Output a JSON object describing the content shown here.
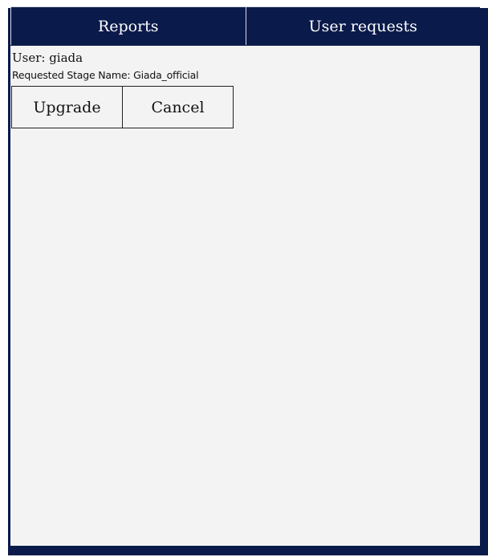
{
  "tabs": [
    {
      "label": "Reports"
    },
    {
      "label": "User requests"
    }
  ],
  "request": {
    "user_label": "User: giada",
    "stage_name_label": "Requested Stage Name: Giada_official"
  },
  "actions": {
    "upgrade_label": "Upgrade",
    "cancel_label": "Cancel"
  },
  "colors": {
    "navy": "#0a1a4a",
    "panel": "#f3f3f3"
  }
}
